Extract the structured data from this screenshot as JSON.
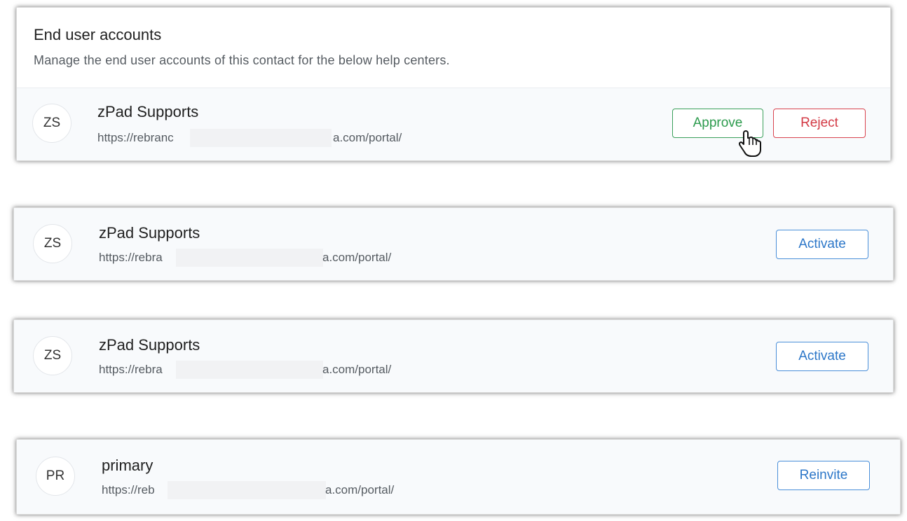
{
  "section": {
    "title": "End user accounts",
    "subtitle": "Manage the end user accounts of this contact for the below help centers."
  },
  "accounts": [
    {
      "initials": "ZS",
      "name": "zPad Supports",
      "url_prefix": "https://rebranc",
      "url_suffix": "a.com/portal/",
      "actions": [
        "Approve",
        "Reject"
      ]
    },
    {
      "initials": "ZS",
      "name": "zPad Supports",
      "url_prefix": "https://rebra",
      "url_suffix": "a.com/portal/",
      "actions": [
        "Activate"
      ]
    },
    {
      "initials": "ZS",
      "name": "zPad Supports",
      "url_prefix": "https://rebra",
      "url_suffix": "a.com/portal/",
      "actions": [
        "Activate"
      ]
    },
    {
      "initials": "PR",
      "name": "primary",
      "url_prefix": "https://reb",
      "url_suffix": "a.com/portal/",
      "actions": [
        "Reinvite"
      ]
    }
  ],
  "colors": {
    "approve": "#2d9b4e",
    "reject": "#d33a45",
    "primary_action": "#2b76c8",
    "row_background": "#f8fafc"
  },
  "icons": {
    "cursor": "hand-pointer-icon"
  }
}
